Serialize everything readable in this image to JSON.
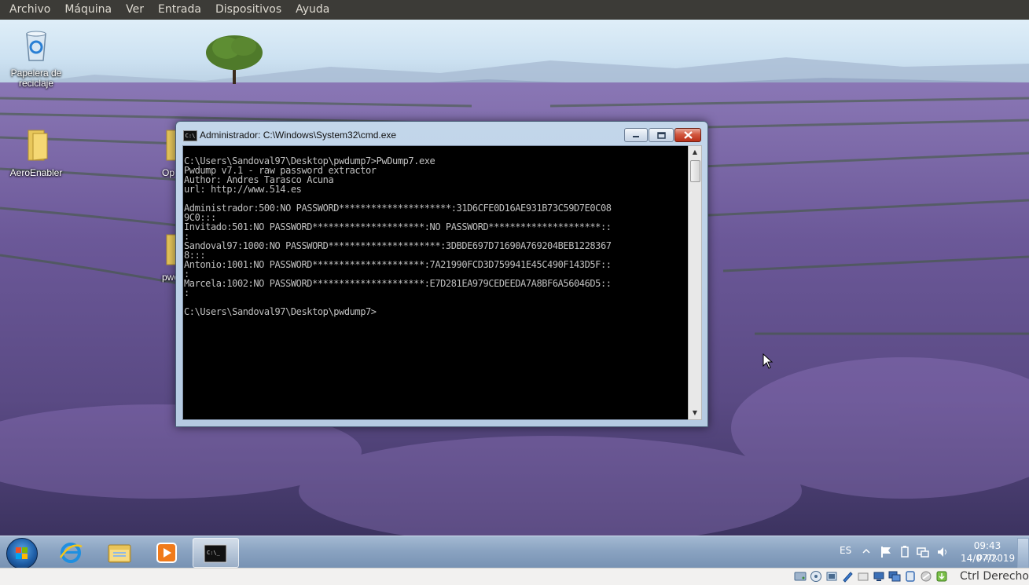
{
  "vbox_menu": [
    "Archivo",
    "Máquina",
    "Ver",
    "Entrada",
    "Dispositivos",
    "Ayuda"
  ],
  "desktop_icons": {
    "recycle_bin": "Papelera de reciclaje",
    "aero_enabler": "AeroEnabler",
    "partial_op": "Op",
    "partial_pw": "pwd"
  },
  "cmd": {
    "title": "Administrador: C:\\Windows\\System32\\cmd.exe",
    "output": "C:\\Users\\Sandoval97\\Desktop\\pwdump7>PwDump7.exe\nPwdump v7.1 - raw password extractor\nAuthor: Andres Tarasco Acuna\nurl: http://www.514.es\n\nAdministrador:500:NO PASSWORD*********************:31D6CFE0D16AE931B73C59D7E0C08\n9C0:::\nInvitado:501:NO PASSWORD*********************:NO PASSWORD*********************::\n:\nSandoval97:1000:NO PASSWORD*********************:3DBDE697D71690A769204BEB1228367\n8:::\nAntonio:1001:NO PASSWORD*********************:7A21990FCD3D759941E45C490F143D5F::\n:\nMarcela:1002:NO PASSWORD*********************:E7D281EA979CEDEEDA7A8BF6A56046D5::\n:\n\nC:\\Users\\Sandoval97\\Desktop\\pwdump7>"
  },
  "tray": {
    "language": "ES",
    "time": "09:43 p.m.",
    "date": "14/07/2019"
  },
  "vbox_status": {
    "host_key": "Ctrl Derecho"
  }
}
